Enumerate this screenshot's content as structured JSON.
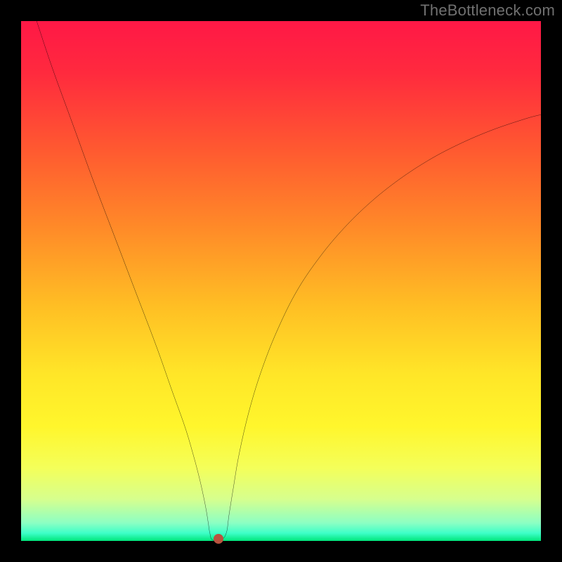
{
  "watermark": "TheBottleneck.com",
  "chart_data": {
    "type": "line",
    "title": "",
    "xlabel": "",
    "ylabel": "",
    "xlim": [
      0,
      100
    ],
    "ylim": [
      0,
      100
    ],
    "gradient_stops": [
      {
        "offset": 0.0,
        "color": "#ff1846"
      },
      {
        "offset": 0.1,
        "color": "#ff2a3e"
      },
      {
        "offset": 0.25,
        "color": "#ff5a30"
      },
      {
        "offset": 0.4,
        "color": "#ff8b28"
      },
      {
        "offset": 0.55,
        "color": "#ffbf24"
      },
      {
        "offset": 0.68,
        "color": "#ffe628"
      },
      {
        "offset": 0.78,
        "color": "#fff62c"
      },
      {
        "offset": 0.86,
        "color": "#f4ff5a"
      },
      {
        "offset": 0.92,
        "color": "#d6ff8e"
      },
      {
        "offset": 0.965,
        "color": "#8dffc3"
      },
      {
        "offset": 0.985,
        "color": "#3effc8"
      },
      {
        "offset": 1.0,
        "color": "#00e57a"
      }
    ],
    "series": [
      {
        "name": "bottleneck-curve",
        "color": "#000000",
        "x": [
          3.0,
          6.0,
          10.0,
          14.0,
          18.0,
          22.0,
          26.0,
          29.0,
          31.5,
          33.0,
          34.2,
          35.0,
          35.6,
          36.0,
          36.3,
          36.8,
          38.5,
          39.5,
          40.0,
          40.8,
          42.0,
          44.0,
          46.5,
          49.5,
          53.0,
          57.0,
          61.5,
          66.5,
          72.0,
          78.0,
          84.0,
          90.5,
          97.0,
          100.0
        ],
        "y": [
          100.0,
          91.0,
          80.0,
          69.0,
          58.5,
          48.0,
          37.5,
          29.0,
          22.0,
          17.0,
          12.5,
          9.0,
          6.0,
          3.5,
          1.6,
          0.2,
          0.2,
          1.6,
          5.0,
          10.0,
          17.0,
          25.5,
          33.5,
          41.0,
          48.0,
          54.0,
          59.5,
          64.5,
          69.0,
          73.0,
          76.2,
          79.0,
          81.2,
          82.0
        ]
      }
    ],
    "marker": {
      "x": 38.0,
      "y": 0.4,
      "color": "#b9533f",
      "radius_px": 7
    }
  }
}
